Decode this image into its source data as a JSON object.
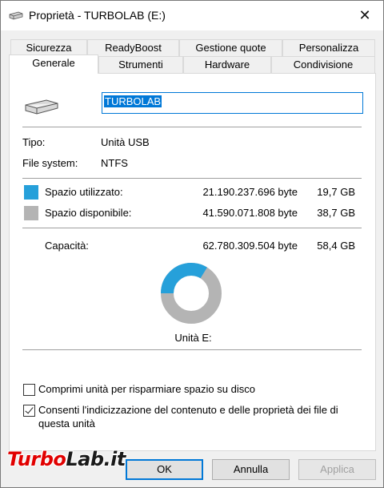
{
  "window": {
    "title": "Proprietà - TURBOLAB (E:)",
    "close_glyph": "✕"
  },
  "tabs_row1": [
    "Sicurezza",
    "ReadyBoost",
    "Gestione quote",
    "Personalizza"
  ],
  "tabs_row2": [
    "Generale",
    "Strumenti",
    "Hardware",
    "Condivisione"
  ],
  "active_tab": "Generale",
  "general": {
    "drive_name": "TURBOLAB",
    "type_label": "Tipo:",
    "type_value": "Unità USB",
    "fs_label": "File system:",
    "fs_value": "NTFS",
    "used_label": "Spazio utilizzato:",
    "used_bytes": "21.190.237.696 byte",
    "used_gb": "19,7 GB",
    "free_label": "Spazio disponibile:",
    "free_bytes": "41.590.071.808 byte",
    "free_gb": "38,7 GB",
    "capacity_label": "Capacità:",
    "capacity_bytes": "62.780.309.504 byte",
    "capacity_gb": "58,4 GB",
    "drive_label": "Unità E:",
    "used_fraction": 0.3375,
    "used_color": "#26a0da",
    "free_color": "#b4b4b4",
    "compress_label": "Comprimi unità per risparmiare spazio su disco",
    "compress_checked": false,
    "index_label_line1": "Consenti l'indicizzazione del contenuto e delle proprietà dei file di",
    "index_label_line2": "questa unità",
    "index_checked": true
  },
  "buttons": {
    "ok": "OK",
    "cancel": "Annulla",
    "apply": "Applica"
  },
  "watermark": {
    "part1": "Turbo",
    "part2": "Lab.it"
  }
}
